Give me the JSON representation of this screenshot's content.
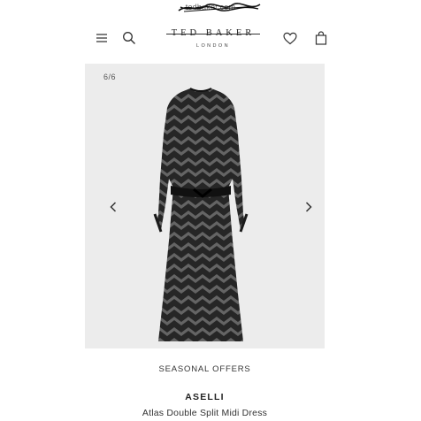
{
  "browser": {
    "url": "tedbaker.com"
  },
  "header": {
    "menu_icon": "hamburger-icon",
    "search_icon": "search-icon",
    "logo_main": "TED BAKER",
    "logo_sub": "LONDON",
    "wishlist_icon": "heart-icon",
    "bag_icon": "bag-icon"
  },
  "gallery": {
    "counter": "6/6",
    "prev_icon": "chevron-left-icon",
    "next_icon": "chevron-right-icon",
    "background": "#ececec"
  },
  "product": {
    "promo": "SEASONAL OFFERS",
    "brand": "ASELLI",
    "name": "Atlas Double Split Midi Dress"
  }
}
